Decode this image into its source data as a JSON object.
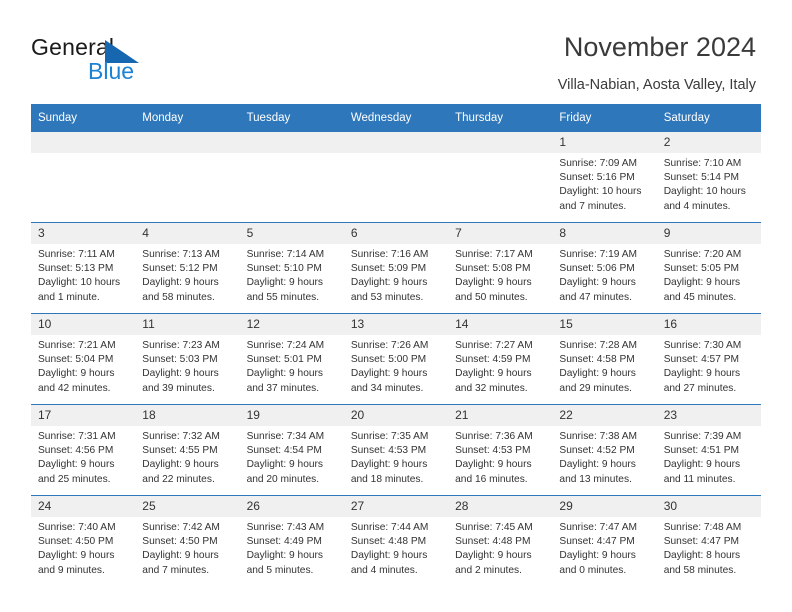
{
  "brand": {
    "name_part1": "General",
    "name_part2": "Blue",
    "triangle_color": "#1666b0",
    "blue_text_color": "#1b82d4"
  },
  "header": {
    "month_title": "November 2024",
    "location": "Villa-Nabian, Aosta Valley, Italy"
  },
  "theme": {
    "header_blue": "#2e77bb",
    "daynum_bg": "#f0f0f0",
    "text": "#333333"
  },
  "calendar": {
    "weekday_headers": [
      "Sunday",
      "Monday",
      "Tuesday",
      "Wednesday",
      "Thursday",
      "Friday",
      "Saturday"
    ],
    "weeks": [
      [
        {
          "day": "",
          "blank": true,
          "lines": [
            "",
            "",
            "",
            ""
          ]
        },
        {
          "day": "",
          "blank": true,
          "lines": [
            "",
            "",
            "",
            ""
          ]
        },
        {
          "day": "",
          "blank": true,
          "lines": [
            "",
            "",
            "",
            ""
          ]
        },
        {
          "day": "",
          "blank": true,
          "lines": [
            "",
            "",
            "",
            ""
          ]
        },
        {
          "day": "",
          "blank": true,
          "lines": [
            "",
            "",
            "",
            ""
          ]
        },
        {
          "day": "1",
          "blank": false,
          "lines": [
            "Sunrise: 7:09 AM",
            "Sunset: 5:16 PM",
            "Daylight: 10 hours",
            "and 7 minutes."
          ]
        },
        {
          "day": "2",
          "blank": false,
          "lines": [
            "Sunrise: 7:10 AM",
            "Sunset: 5:14 PM",
            "Daylight: 10 hours",
            "and 4 minutes."
          ]
        }
      ],
      [
        {
          "day": "3",
          "blank": false,
          "lines": [
            "Sunrise: 7:11 AM",
            "Sunset: 5:13 PM",
            "Daylight: 10 hours",
            "and 1 minute."
          ]
        },
        {
          "day": "4",
          "blank": false,
          "lines": [
            "Sunrise: 7:13 AM",
            "Sunset: 5:12 PM",
            "Daylight: 9 hours",
            "and 58 minutes."
          ]
        },
        {
          "day": "5",
          "blank": false,
          "lines": [
            "Sunrise: 7:14 AM",
            "Sunset: 5:10 PM",
            "Daylight: 9 hours",
            "and 55 minutes."
          ]
        },
        {
          "day": "6",
          "blank": false,
          "lines": [
            "Sunrise: 7:16 AM",
            "Sunset: 5:09 PM",
            "Daylight: 9 hours",
            "and 53 minutes."
          ]
        },
        {
          "day": "7",
          "blank": false,
          "lines": [
            "Sunrise: 7:17 AM",
            "Sunset: 5:08 PM",
            "Daylight: 9 hours",
            "and 50 minutes."
          ]
        },
        {
          "day": "8",
          "blank": false,
          "lines": [
            "Sunrise: 7:19 AM",
            "Sunset: 5:06 PM",
            "Daylight: 9 hours",
            "and 47 minutes."
          ]
        },
        {
          "day": "9",
          "blank": false,
          "lines": [
            "Sunrise: 7:20 AM",
            "Sunset: 5:05 PM",
            "Daylight: 9 hours",
            "and 45 minutes."
          ]
        }
      ],
      [
        {
          "day": "10",
          "blank": false,
          "lines": [
            "Sunrise: 7:21 AM",
            "Sunset: 5:04 PM",
            "Daylight: 9 hours",
            "and 42 minutes."
          ]
        },
        {
          "day": "11",
          "blank": false,
          "lines": [
            "Sunrise: 7:23 AM",
            "Sunset: 5:03 PM",
            "Daylight: 9 hours",
            "and 39 minutes."
          ]
        },
        {
          "day": "12",
          "blank": false,
          "lines": [
            "Sunrise: 7:24 AM",
            "Sunset: 5:01 PM",
            "Daylight: 9 hours",
            "and 37 minutes."
          ]
        },
        {
          "day": "13",
          "blank": false,
          "lines": [
            "Sunrise: 7:26 AM",
            "Sunset: 5:00 PM",
            "Daylight: 9 hours",
            "and 34 minutes."
          ]
        },
        {
          "day": "14",
          "blank": false,
          "lines": [
            "Sunrise: 7:27 AM",
            "Sunset: 4:59 PM",
            "Daylight: 9 hours",
            "and 32 minutes."
          ]
        },
        {
          "day": "15",
          "blank": false,
          "lines": [
            "Sunrise: 7:28 AM",
            "Sunset: 4:58 PM",
            "Daylight: 9 hours",
            "and 29 minutes."
          ]
        },
        {
          "day": "16",
          "blank": false,
          "lines": [
            "Sunrise: 7:30 AM",
            "Sunset: 4:57 PM",
            "Daylight: 9 hours",
            "and 27 minutes."
          ]
        }
      ],
      [
        {
          "day": "17",
          "blank": false,
          "lines": [
            "Sunrise: 7:31 AM",
            "Sunset: 4:56 PM",
            "Daylight: 9 hours",
            "and 25 minutes."
          ]
        },
        {
          "day": "18",
          "blank": false,
          "lines": [
            "Sunrise: 7:32 AM",
            "Sunset: 4:55 PM",
            "Daylight: 9 hours",
            "and 22 minutes."
          ]
        },
        {
          "day": "19",
          "blank": false,
          "lines": [
            "Sunrise: 7:34 AM",
            "Sunset: 4:54 PM",
            "Daylight: 9 hours",
            "and 20 minutes."
          ]
        },
        {
          "day": "20",
          "blank": false,
          "lines": [
            "Sunrise: 7:35 AM",
            "Sunset: 4:53 PM",
            "Daylight: 9 hours",
            "and 18 minutes."
          ]
        },
        {
          "day": "21",
          "blank": false,
          "lines": [
            "Sunrise: 7:36 AM",
            "Sunset: 4:53 PM",
            "Daylight: 9 hours",
            "and 16 minutes."
          ]
        },
        {
          "day": "22",
          "blank": false,
          "lines": [
            "Sunrise: 7:38 AM",
            "Sunset: 4:52 PM",
            "Daylight: 9 hours",
            "and 13 minutes."
          ]
        },
        {
          "day": "23",
          "blank": false,
          "lines": [
            "Sunrise: 7:39 AM",
            "Sunset: 4:51 PM",
            "Daylight: 9 hours",
            "and 11 minutes."
          ]
        }
      ],
      [
        {
          "day": "24",
          "blank": false,
          "lines": [
            "Sunrise: 7:40 AM",
            "Sunset: 4:50 PM",
            "Daylight: 9 hours",
            "and 9 minutes."
          ]
        },
        {
          "day": "25",
          "blank": false,
          "lines": [
            "Sunrise: 7:42 AM",
            "Sunset: 4:50 PM",
            "Daylight: 9 hours",
            "and 7 minutes."
          ]
        },
        {
          "day": "26",
          "blank": false,
          "lines": [
            "Sunrise: 7:43 AM",
            "Sunset: 4:49 PM",
            "Daylight: 9 hours",
            "and 5 minutes."
          ]
        },
        {
          "day": "27",
          "blank": false,
          "lines": [
            "Sunrise: 7:44 AM",
            "Sunset: 4:48 PM",
            "Daylight: 9 hours",
            "and 4 minutes."
          ]
        },
        {
          "day": "28",
          "blank": false,
          "lines": [
            "Sunrise: 7:45 AM",
            "Sunset: 4:48 PM",
            "Daylight: 9 hours",
            "and 2 minutes."
          ]
        },
        {
          "day": "29",
          "blank": false,
          "lines": [
            "Sunrise: 7:47 AM",
            "Sunset: 4:47 PM",
            "Daylight: 9 hours",
            "and 0 minutes."
          ]
        },
        {
          "day": "30",
          "blank": false,
          "lines": [
            "Sunrise: 7:48 AM",
            "Sunset: 4:47 PM",
            "Daylight: 8 hours",
            "and 58 minutes."
          ]
        }
      ]
    ]
  }
}
